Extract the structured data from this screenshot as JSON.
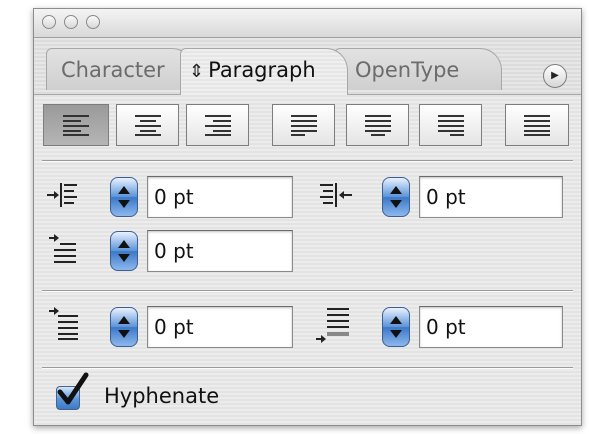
{
  "window": {
    "traffic_lights": [
      "close",
      "minimize",
      "zoom"
    ]
  },
  "tabs": [
    {
      "label": "Character",
      "active": false
    },
    {
      "label": "Paragraph",
      "active": true,
      "icon": "updown-arrows-icon"
    },
    {
      "label": "OpenType",
      "active": false
    }
  ],
  "panel_menu_icon": "triangle-right-icon",
  "alignment_buttons": [
    {
      "name": "align-left",
      "selected": true
    },
    {
      "name": "align-center",
      "selected": false
    },
    {
      "name": "align-right",
      "selected": false
    },
    {
      "name": "justify-last-left",
      "selected": false
    },
    {
      "name": "justify-last-center",
      "selected": false
    },
    {
      "name": "justify-last-right",
      "selected": false
    },
    {
      "name": "justify-all",
      "selected": false
    }
  ],
  "indents": {
    "left_indent": {
      "value": "0 pt",
      "icon": "left-indent-icon"
    },
    "right_indent": {
      "value": "0 pt",
      "icon": "right-indent-icon"
    },
    "first_line_indent": {
      "value": "0 pt",
      "icon": "first-line-indent-icon"
    }
  },
  "spacing": {
    "space_before": {
      "value": "0 pt",
      "icon": "space-before-icon"
    },
    "space_after": {
      "value": "0 pt",
      "icon": "space-after-icon"
    }
  },
  "hyphenate": {
    "label": "Hyphenate",
    "checked": true
  },
  "colors": {
    "stepper_blue": "#4a86d2",
    "selected_button": "#a8a8a8",
    "check_blue": "#3f79c5"
  }
}
